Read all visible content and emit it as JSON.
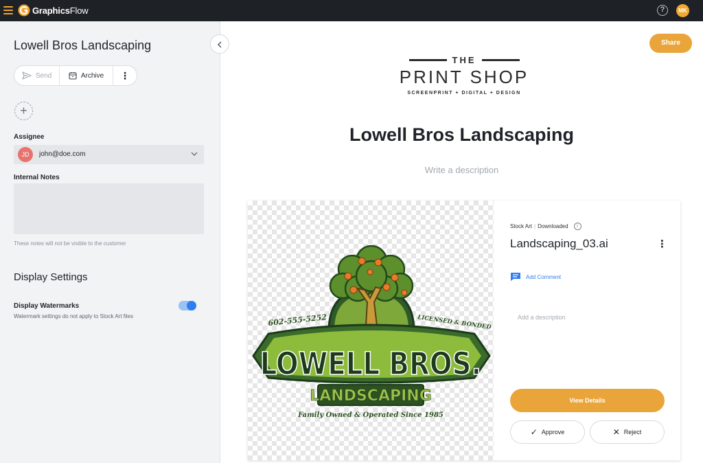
{
  "app": {
    "brand_bold": "Graphics",
    "brand_light": "Flow",
    "user_initials": "MK"
  },
  "sidebar": {
    "title": "Lowell Bros Landscaping",
    "actions": {
      "send": "Send",
      "archive": "Archive"
    },
    "assignee_label": "Assignee",
    "assignee": {
      "initials": "JD",
      "email": "john@doe.com"
    },
    "notes_label": "Internal Notes",
    "notes_value": "",
    "notes_hint": "These notes will not be visible to the customer",
    "display_heading": "Display Settings",
    "watermark_label": "Display Watermarks",
    "watermark_hint": "Watermark settings do not apply to Stock Art files",
    "watermark_enabled": true
  },
  "main": {
    "share": "Share",
    "brand": {
      "the": "THE",
      "name": "PRINT SHOP",
      "tagline": "SCREENPRINT + DIGITAL + DESIGN"
    },
    "title": "Lowell Bros Landscaping",
    "description_placeholder": "Write a description"
  },
  "card": {
    "logo": {
      "phone": "602-555-5252",
      "licensed": "LICENSED & BONDED",
      "name": "LOWELL BROS.",
      "sub": "LANDSCAPING",
      "tagline": "Family Owned & Operated Since 1985"
    },
    "source": "Stock Art",
    "status": "Downloaded",
    "file_name": "Landscaping_03.ai",
    "add_comment": "Add Comment",
    "description_placeholder": "Add a description",
    "view_details": "View Details",
    "approve": "Approve",
    "reject": "Reject"
  },
  "colors": {
    "accent": "#eaa53a",
    "link": "#2f7ef0",
    "topbar": "#1e2126"
  },
  "icons": [
    "menu-icon",
    "help-icon",
    "send-icon",
    "archive-icon",
    "more-vertical-icon",
    "plus-icon",
    "chevron-down-icon",
    "chevron-left-icon",
    "info-icon",
    "comment-icon",
    "check-icon",
    "x-icon"
  ]
}
